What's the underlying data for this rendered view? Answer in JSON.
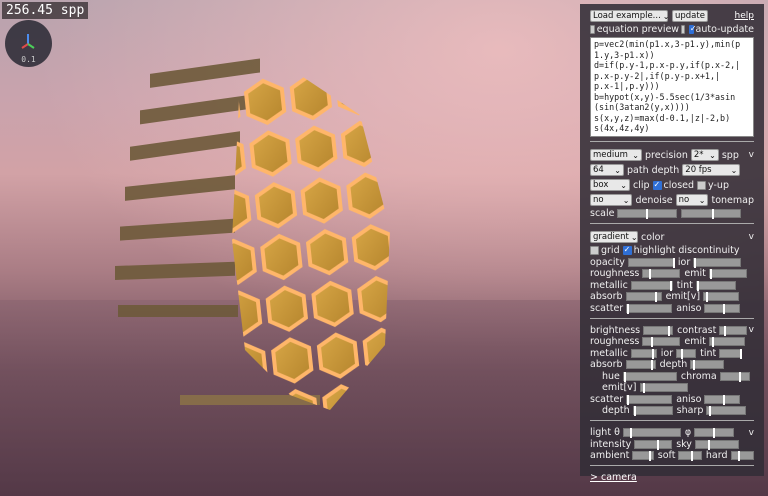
{
  "render_stats": {
    "spp": "256.45 spp"
  },
  "gizmo": {
    "scale": "0.1"
  },
  "panel": {
    "load_example": "Load example...",
    "update": "update",
    "help": "help",
    "equation_preview": "equation preview",
    "equation_preview_checked": false,
    "auto_update": "auto-update",
    "auto_update_checked": true,
    "code": "p=vec2(min(p1.x,3-p1.y),min(p\n1.y,3-p1.x))\nd=if(p.y-1,p.x-p.y,if(p.x-2,|\np.x-p.y-2|,if(p.y-p.x+1,|\np.x-1|,p.y)))\nb=hypot(x,y)-5.5sec(1/3*asin\n(sin(3atan2(y,x))))\ns(x,y,z)=max(d-0.1,|z|-2,b)\ns(4x,4z,4y)",
    "render": {
      "precision_value": "medium",
      "precision_label": "precision",
      "spp_value": "2*",
      "spp_label": "spp",
      "path_depth_value": "64",
      "path_depth_label": "path depth",
      "fps_value": "20 fps",
      "clip_value": "box",
      "clip_label": "clip",
      "closed_label": "closed",
      "closed_checked": true,
      "yup_label": "y-up",
      "yup_checked": false,
      "denoise_value": "no",
      "denoise_label": "denoise",
      "tonemap_value": "no",
      "tonemap_label": "tonemap",
      "scale_label": "scale",
      "collapse": "v"
    },
    "material": {
      "color_mode": "gradient",
      "color_label": "color",
      "grid_label": "grid",
      "grid_checked": false,
      "highlight_label": "highlight discontinuity",
      "highlight_checked": true,
      "opacity": "opacity",
      "ior": "ior",
      "roughness": "roughness",
      "emit": "emit",
      "metallic": "metallic",
      "tint": "tint",
      "absorb": "absorb",
      "emit_v": "emit[v]",
      "scatter": "scatter",
      "aniso": "aniso",
      "collapse": "v"
    },
    "material2": {
      "brightness": "brightness",
      "contrast": "contrast",
      "roughness": "roughness",
      "emit": "emit",
      "metallic": "metallic",
      "ior": "ior",
      "tint": "tint",
      "absorb": "absorb",
      "depth": "depth",
      "hue": "hue",
      "chroma": "chroma",
      "emit_v": "emit[v]",
      "scatter": "scatter",
      "aniso": "aniso",
      "depth2": "depth",
      "sharp": "sharp",
      "collapse": "v"
    },
    "light": {
      "light_theta": "light θ",
      "phi": "φ",
      "intensity": "intensity",
      "sky": "sky",
      "ambient": "ambient",
      "soft": "soft",
      "hard": "hard",
      "collapse": "v"
    },
    "camera_link": "> camera"
  },
  "colors": {
    "accent": "#2f6fd6",
    "object_glow": "#f0a060"
  }
}
